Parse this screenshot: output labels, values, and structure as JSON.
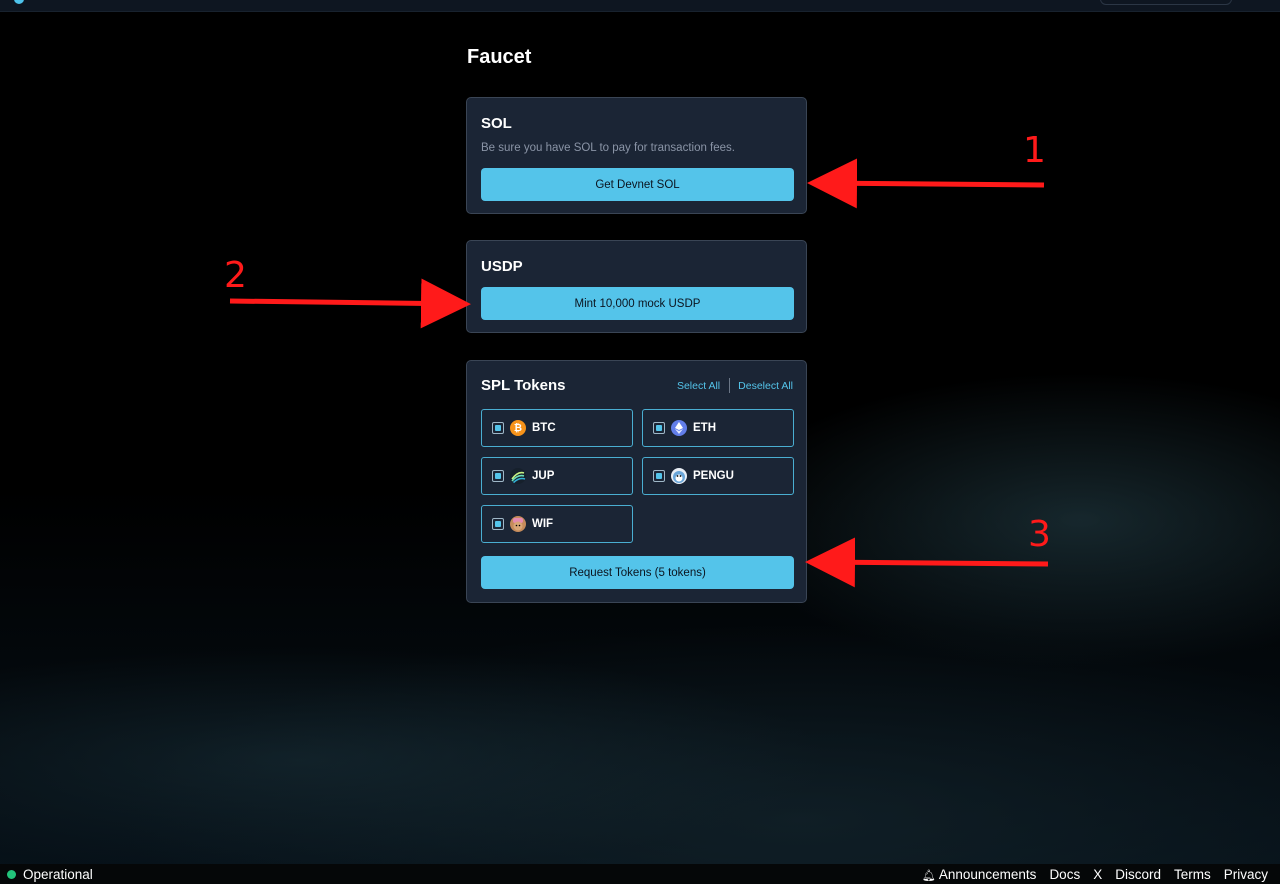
{
  "page": {
    "title": "Faucet"
  },
  "sol_card": {
    "title": "SOL",
    "description": "Be sure you have SOL to pay for transaction fees.",
    "button_label": "Get Devnet SOL"
  },
  "usdp_card": {
    "title": "USDP",
    "button_label": "Mint 10,000 mock USDP"
  },
  "spl_card": {
    "title": "SPL Tokens",
    "select_all": "Select All",
    "deselect_all": "Deselect All",
    "tokens": [
      {
        "symbol": "BTC",
        "checked": true,
        "icon": "btc-icon"
      },
      {
        "symbol": "ETH",
        "checked": true,
        "icon": "eth-icon"
      },
      {
        "symbol": "JUP",
        "checked": true,
        "icon": "jup-icon"
      },
      {
        "symbol": "PENGU",
        "checked": true,
        "icon": "pengu-icon"
      },
      {
        "symbol": "WIF",
        "checked": true,
        "icon": "wif-icon"
      }
    ],
    "button_label": "Request Tokens (5 tokens)"
  },
  "annotations": {
    "one": "1",
    "two": "2",
    "three": "3"
  },
  "footer": {
    "status": "Operational",
    "links": [
      "Announcements",
      "Docs",
      "X",
      "Discord",
      "Terms",
      "Privacy"
    ]
  },
  "colors": {
    "accent": "#54c4ea",
    "card_bg": "#1b2535",
    "status_green": "#22c37a",
    "annotation_red": "#ff1a1a"
  }
}
